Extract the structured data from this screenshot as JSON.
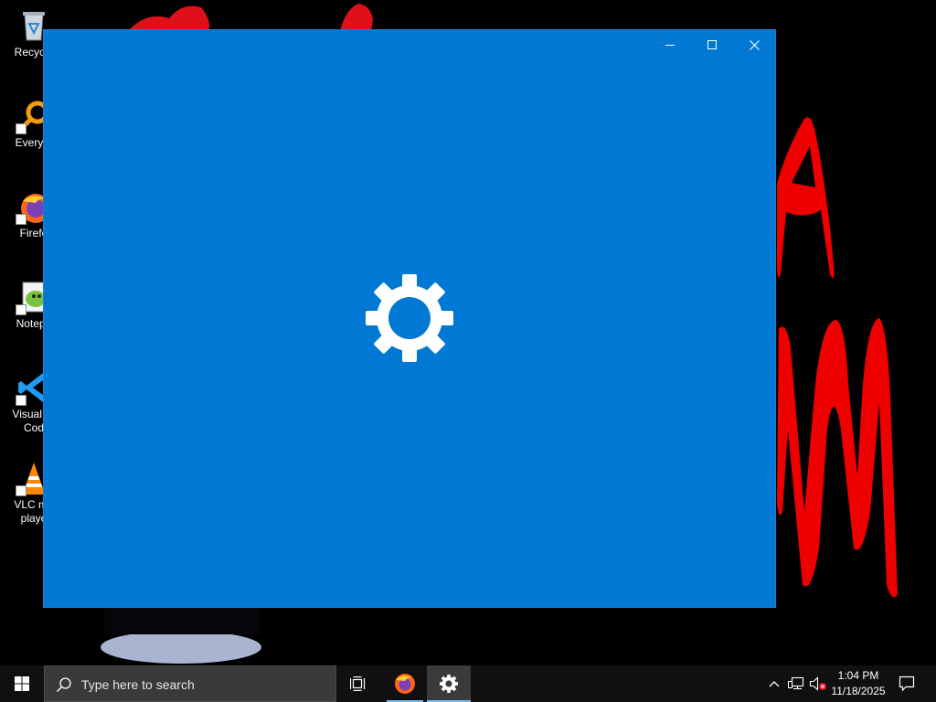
{
  "desktop": {
    "icons": [
      {
        "label": "Recycle",
        "icon": "recycle-bin-icon"
      },
      {
        "label": "Everyth",
        "icon": "everything-search-icon"
      },
      {
        "label": "Firefo",
        "icon": "firefox-icon"
      },
      {
        "label": "Notepa",
        "icon": "notepad-plus-plus-icon"
      },
      {
        "label": "Visual St\nCod",
        "icon": "vscode-icon"
      },
      {
        "label": "VLC me\nplaye",
        "icon": "vlc-icon"
      }
    ]
  },
  "window": {
    "app": "Settings",
    "background": "#0078d4",
    "splash_icon": "gear-icon",
    "controls": [
      "minimize-icon",
      "maximize-icon",
      "close-icon"
    ]
  },
  "taskbar": {
    "start_icon": "windows-logo-icon",
    "search": {
      "placeholder": "Type here to search",
      "icon": "search-icon"
    },
    "pinned": [
      {
        "name": "Task View",
        "icon": "task-view-icon"
      },
      {
        "name": "Firefox",
        "icon": "firefox-icon",
        "running": true
      },
      {
        "name": "Settings",
        "icon": "gear-icon",
        "active": true
      }
    ],
    "tray": {
      "time": "1:04 PM",
      "date": "11/18/2025",
      "icons": [
        "chevron-up-icon",
        "network-icon",
        "volume-muted-icon",
        "notification-icon"
      ]
    },
    "accent": "#76b9ed"
  }
}
